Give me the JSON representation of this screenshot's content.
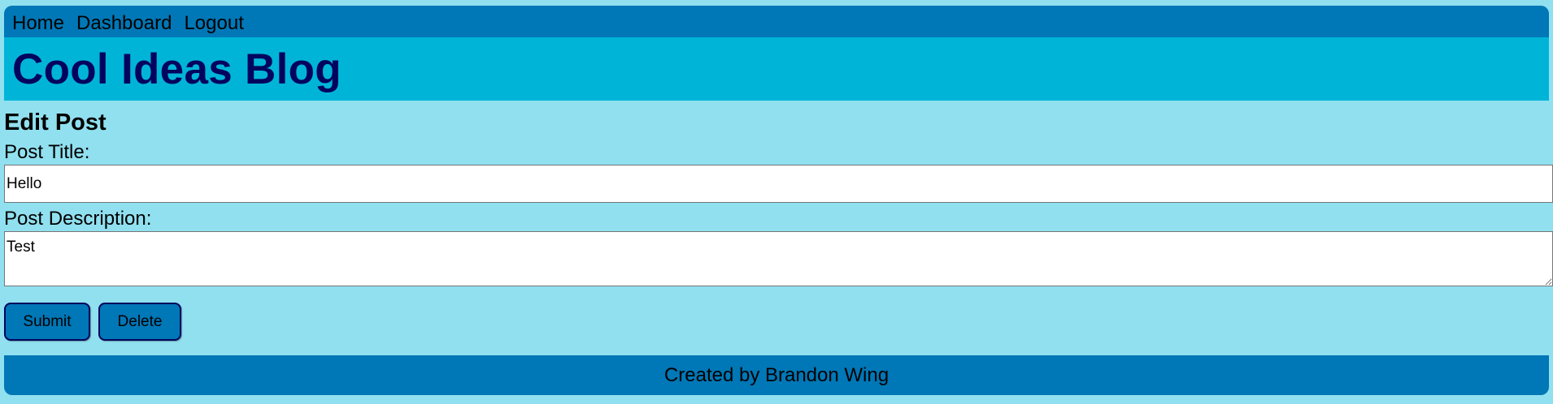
{
  "nav": {
    "home": "Home",
    "dashboard": "Dashboard",
    "logout": "Logout"
  },
  "banner": {
    "title": "Cool Ideas Blog"
  },
  "form": {
    "heading": "Edit Post",
    "title_label": "Post Title:",
    "title_value": "Hello",
    "description_label": "Post Description:",
    "description_value": "Test",
    "submit_label": "Submit",
    "delete_label": "Delete"
  },
  "footer": {
    "text": "Created by Brandon Wing"
  },
  "colors": {
    "page_background": "#90e0ef",
    "nav_background": "#0077b6",
    "banner_background": "#00b4d8",
    "title_color": "#03045e",
    "button_background": "#0077b6",
    "footer_background": "#0077b6"
  }
}
